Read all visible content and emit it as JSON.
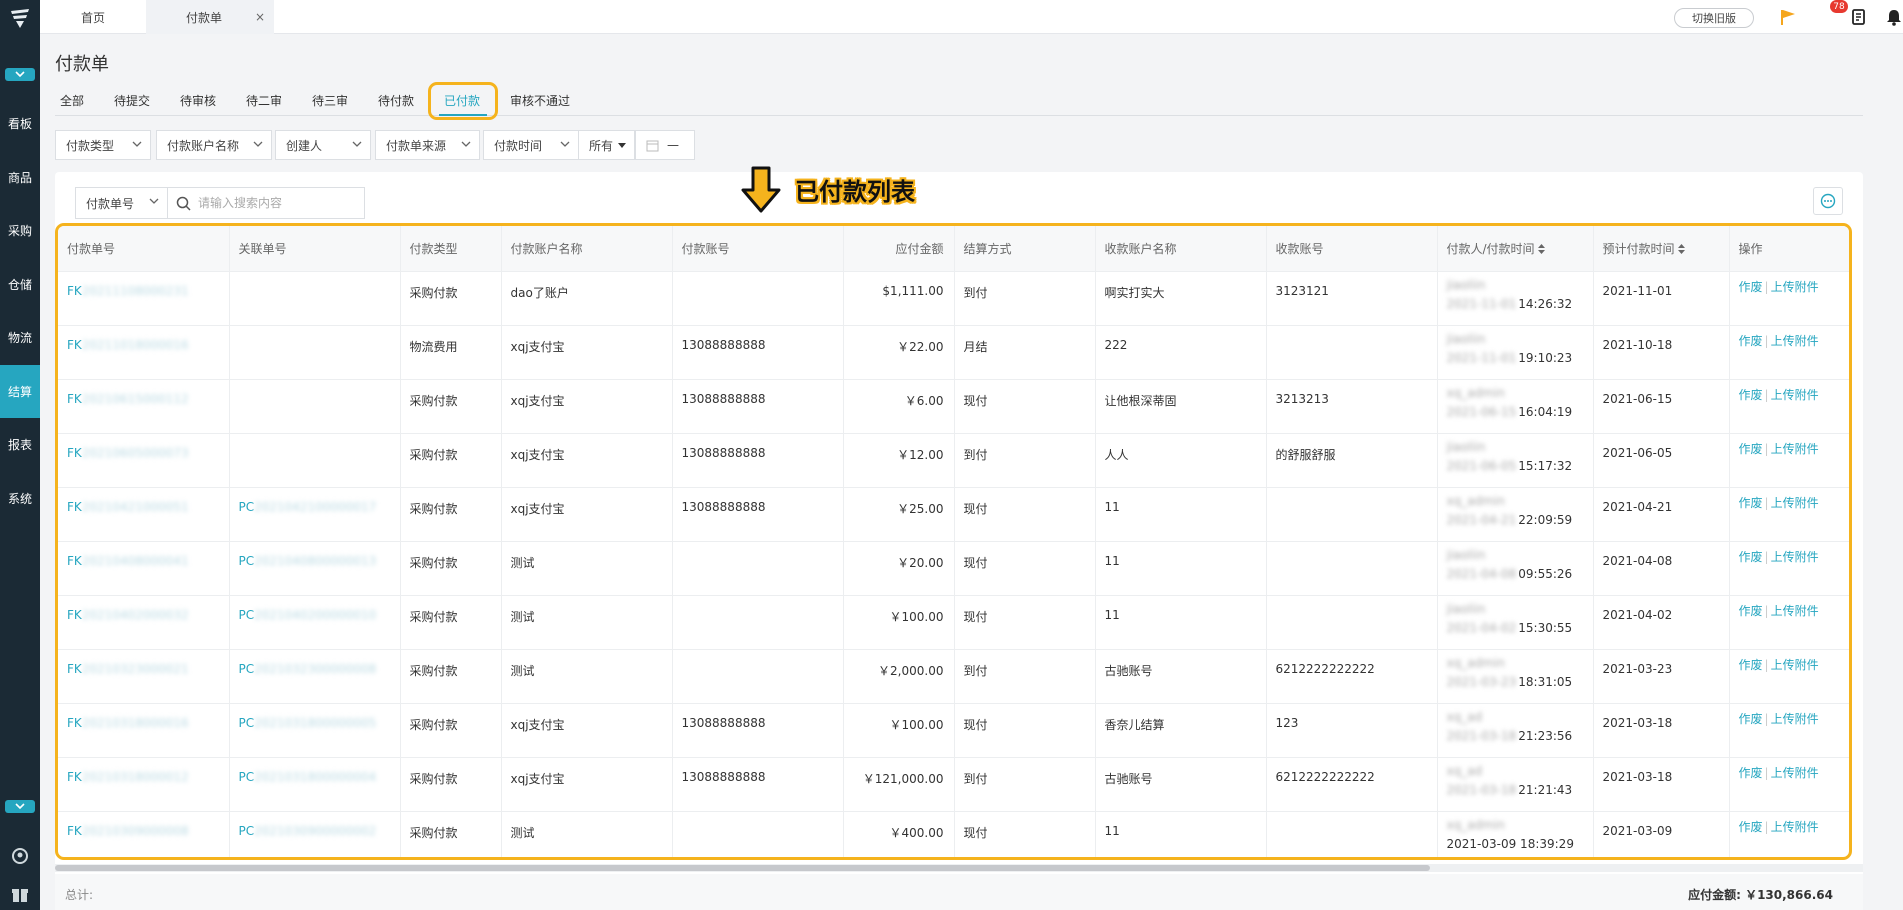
{
  "sidebar": {
    "items": [
      {
        "label": "看板",
        "active": false
      },
      {
        "label": "商品",
        "active": false
      },
      {
        "label": "采购",
        "active": false
      },
      {
        "label": "仓储",
        "active": false
      },
      {
        "label": "物流",
        "active": false
      },
      {
        "label": "结算",
        "active": true
      },
      {
        "label": "报表",
        "active": false
      },
      {
        "label": "系统",
        "active": false
      }
    ]
  },
  "topbar": {
    "home_tab": "首页",
    "current_tab": "付款单",
    "close_symbol": "×",
    "old_version_button": "切换旧版",
    "notification_count": "78"
  },
  "page": {
    "title": "付款单",
    "status_tabs": [
      "全部",
      "待提交",
      "待审核",
      "待二审",
      "待三审",
      "待付款",
      "已付款",
      "审核不通过"
    ],
    "active_status_tab": "已付款"
  },
  "filters": {
    "payment_type": "付款类型",
    "account_name": "付款账户名称",
    "creator": "创建人",
    "source": "付款单来源",
    "pay_time": "付款时间",
    "all": "所有",
    "date_dash": "—"
  },
  "search": {
    "field": "付款单号",
    "placeholder": "请输入搜索内容"
  },
  "annotation": "已付款列表",
  "table": {
    "headers": [
      "付款单号",
      "关联单号",
      "付款类型",
      "付款账户名称",
      "付款账号",
      "应付金额",
      "结算方式",
      "收款账户名称",
      "收款账号",
      "付款人/付款时间",
      "预计付款时间",
      "操作"
    ],
    "rows": [
      {
        "no_prefix": "FK",
        "no_rest": "20211108000231",
        "rel_prefix": "",
        "rel_rest": "",
        "type": "采购付款",
        "account_name": "dao了账户",
        "account_no": "",
        "amount": "$1,111.00",
        "settle": "到付",
        "payee_name": "啊实打实大",
        "payee_no": "3123121",
        "payer": "jiaoliin",
        "date_blur": "2021-11-01",
        "time": "14:26:32",
        "expected": "2021-11-01"
      },
      {
        "no_prefix": "FK",
        "no_rest": "20211018000016",
        "rel_prefix": "",
        "rel_rest": "",
        "type": "物流费用",
        "account_name": "xqj支付宝",
        "account_no": "13088888888",
        "amount": "￥22.00",
        "settle": "月结",
        "payee_name": "222",
        "payee_no": "",
        "payer": "jiaoliin",
        "date_blur": "2021-11-01",
        "time": "19:10:23",
        "expected": "2021-10-18"
      },
      {
        "no_prefix": "FK",
        "no_rest": "20210615000112",
        "rel_prefix": "",
        "rel_rest": "",
        "type": "采购付款",
        "account_name": "xqj支付宝",
        "account_no": "13088888888",
        "amount": "￥6.00",
        "settle": "现付",
        "payee_name": "让他根深蒂固",
        "payee_no": "3213213",
        "payer": "xq_admin",
        "date_blur": "2021-06-15",
        "time": "16:04:19",
        "expected": "2021-06-15"
      },
      {
        "no_prefix": "FK",
        "no_rest": "20210605000073",
        "rel_prefix": "",
        "rel_rest": "",
        "type": "采购付款",
        "account_name": "xqj支付宝",
        "account_no": "13088888888",
        "amount": "￥12.00",
        "settle": "到付",
        "payee_name": "人人",
        "payee_no": "的舒服舒服",
        "payer": "jiaoliin",
        "date_blur": "2021-06-05",
        "time": "15:17:32",
        "expected": "2021-06-05"
      },
      {
        "no_prefix": "FK",
        "no_rest": "20210421000051",
        "rel_prefix": "PC",
        "rel_rest": "2021042100000017",
        "type": "采购付款",
        "account_name": "xqj支付宝",
        "account_no": "13088888888",
        "amount": "￥25.00",
        "settle": "现付",
        "payee_name": "11",
        "payee_no": "",
        "payer": "xq_admin",
        "date_blur": "2021-04-21",
        "time": "22:09:59",
        "expected": "2021-04-21"
      },
      {
        "no_prefix": "FK",
        "no_rest": "20210408000041",
        "rel_prefix": "PC",
        "rel_rest": "2021040800000013",
        "type": "采购付款",
        "account_name": "测试",
        "account_no": "",
        "amount": "￥20.00",
        "settle": "现付",
        "payee_name": "11",
        "payee_no": "",
        "payer": "jiaoliin",
        "date_blur": "2021-04-08",
        "time": "09:55:26",
        "expected": "2021-04-08"
      },
      {
        "no_prefix": "FK",
        "no_rest": "20210402000032",
        "rel_prefix": "PC",
        "rel_rest": "2021040200000010",
        "type": "采购付款",
        "account_name": "测试",
        "account_no": "",
        "amount": "￥100.00",
        "settle": "现付",
        "payee_name": "11",
        "payee_no": "",
        "payer": "jiaoliin",
        "date_blur": "2021-04-02",
        "time": "15:30:55",
        "expected": "2021-04-02"
      },
      {
        "no_prefix": "FK",
        "no_rest": "20210323000021",
        "rel_prefix": "PC",
        "rel_rest": "2021032300000008",
        "type": "采购付款",
        "account_name": "测试",
        "account_no": "",
        "amount": "￥2,000.00",
        "settle": "到付",
        "payee_name": "古驰账号",
        "payee_no": "6212222222222",
        "payer": "xq_admin",
        "date_blur": "2021-03-23",
        "time": "18:31:05",
        "expected": "2021-03-23"
      },
      {
        "no_prefix": "FK",
        "no_rest": "20210318000016",
        "rel_prefix": "PC",
        "rel_rest": "2021031800000005",
        "type": "采购付款",
        "account_name": "xqj支付宝",
        "account_no": "13088888888",
        "amount": "￥100.00",
        "settle": "现付",
        "payee_name": "香奈儿结算",
        "payee_no": "123",
        "payer": "xq_ad",
        "date_blur": "2021-03-18",
        "time": "21:23:56",
        "expected": "2021-03-18"
      },
      {
        "no_prefix": "FK",
        "no_rest": "20210318000012",
        "rel_prefix": "PC",
        "rel_rest": "2021031800000004",
        "type": "采购付款",
        "account_name": "xqj支付宝",
        "account_no": "13088888888",
        "amount": "￥121,000.00",
        "settle": "到付",
        "payee_name": "古驰账号",
        "payee_no": "6212222222222",
        "payer": "xq_ad",
        "date_blur": "2021-03-18",
        "time": "21:21:43",
        "expected": "2021-03-18"
      },
      {
        "no_prefix": "FK",
        "no_rest": "20210309000008",
        "rel_prefix": "PC",
        "rel_rest": "2021030900000002",
        "type": "采购付款",
        "account_name": "测试",
        "account_no": "",
        "amount": "￥400.00",
        "settle": "现付",
        "payee_name": "11",
        "payee_no": "",
        "payer": "xq_admin",
        "date_blur": "",
        "time": "2021-03-09 18:39:29",
        "expected": "2021-03-09"
      }
    ],
    "ops": {
      "void": "作废",
      "sep": "|",
      "upload": "上传附件"
    }
  },
  "footer": {
    "total_label": "总计:",
    "amount": "应付金额: ￥130,866.64"
  },
  "colors": {
    "accent": "#26a6c0",
    "highlight": "#f5b31d",
    "sidebar": "#1b2a35"
  }
}
